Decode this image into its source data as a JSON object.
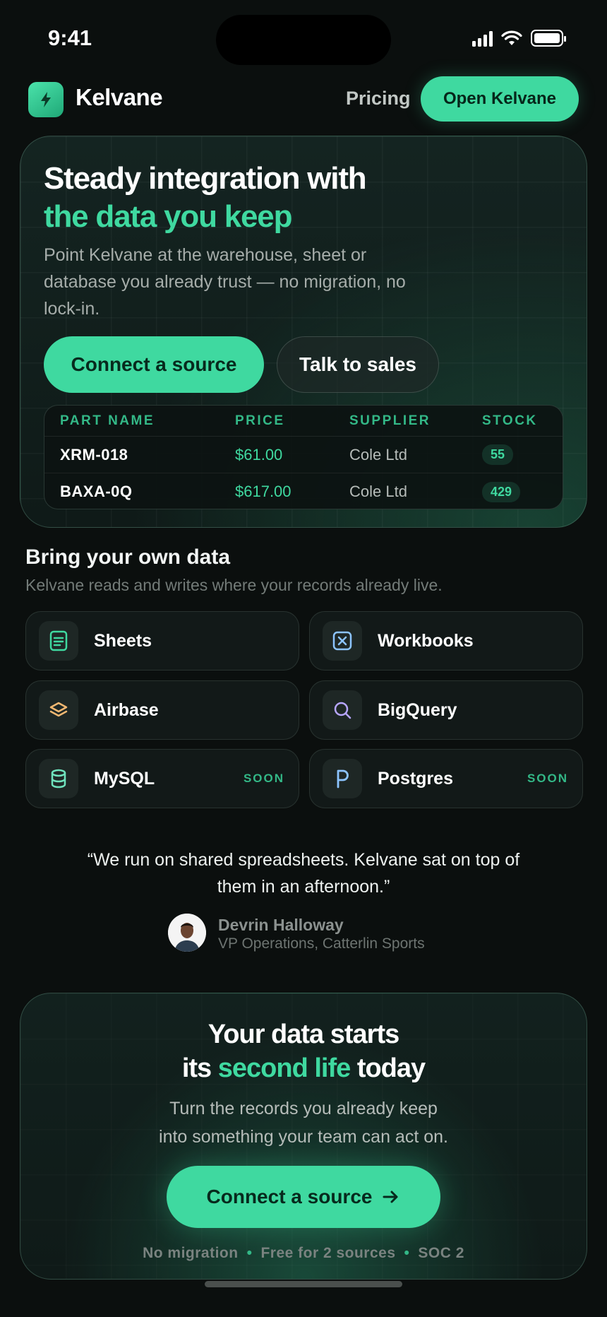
{
  "status_bar": {
    "time": "9:41"
  },
  "nav": {
    "brand": "Kelvane",
    "pricing": "Pricing",
    "open_button": "Open Kelvane"
  },
  "hero": {
    "title_line1": "Steady integration with",
    "title_line2": "the data you keep",
    "subtitle": "Point Kelvane at the warehouse, sheet or database you already trust — no migration, no lock-in.",
    "primary_button": "Connect a source",
    "secondary_button": "Talk to sales",
    "table": {
      "headers": [
        "PART NAME",
        "PRICE",
        "SUPPLIER",
        "STOCK"
      ],
      "rows": [
        {
          "part": "XRM-018",
          "price": "$61.00",
          "supplier": "Cole Ltd",
          "stock": "55"
        },
        {
          "part": "BAXA-0Q",
          "price": "$617.00",
          "supplier": "Cole Ltd",
          "stock": "429"
        }
      ]
    }
  },
  "sources": {
    "title": "Bring your own data",
    "subtitle": "Kelvane reads and writes where your records already live.",
    "items": [
      {
        "name": "Sheets",
        "icon": "sheet-icon",
        "badge": ""
      },
      {
        "name": "Workbooks",
        "icon": "workbook-icon",
        "badge": ""
      },
      {
        "name": "Airbase",
        "icon": "layers-icon",
        "badge": ""
      },
      {
        "name": "BigQuery",
        "icon": "search-icon",
        "badge": ""
      },
      {
        "name": "MySQL",
        "icon": "database-icon",
        "badge": "SOON"
      },
      {
        "name": "Postgres",
        "icon": "postgres-icon",
        "badge": "SOON"
      }
    ]
  },
  "testimonial": {
    "quote": "“We run on shared spreadsheets. Kelvane sat on top of them in an afternoon.”",
    "name": "Devrin Halloway",
    "role": "VP Operations, Catterlin Sports"
  },
  "cta": {
    "title_line1": "Your data starts",
    "title_pre": "its",
    "title_accent": "second life",
    "title_post": "today",
    "subtitle_line1": "Turn the records you already keep",
    "subtitle_line2": "into something your team can act on.",
    "button": "Connect a source",
    "footer": [
      "No migration",
      "Free for 2 sources",
      "SOC 2"
    ]
  },
  "colors": {
    "accent": "#3fd9a0",
    "background": "#0b0f0e"
  }
}
